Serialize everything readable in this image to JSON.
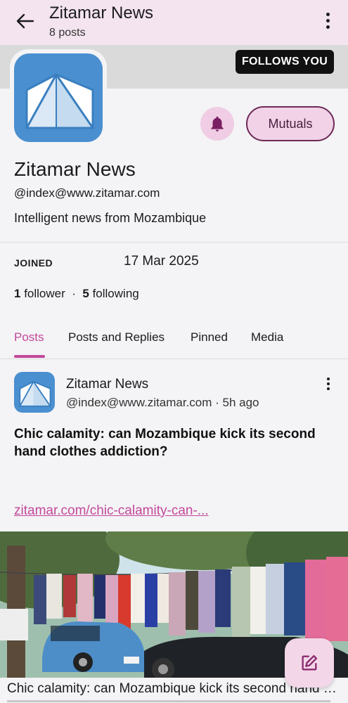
{
  "header": {
    "title": "Zitamar News",
    "subtitle": "8 posts"
  },
  "profile": {
    "follows_you_badge": "FOLLOWS YOU",
    "follow_button_label": "Mutuals",
    "display_name": "Zitamar News",
    "handle": "@index@www.zitamar.com",
    "bio": "Intelligent news from Mozambique",
    "joined_label": "JOINED",
    "joined_value": "17 Mar 2025",
    "followers_count": "1",
    "followers_label": "follower",
    "separator": "·",
    "following_count": "5",
    "following_label": "following"
  },
  "tabs": [
    {
      "label": "Posts",
      "active": true
    },
    {
      "label": "Posts and Replies",
      "active": false
    },
    {
      "label": "Pinned",
      "active": false
    },
    {
      "label": "Media",
      "active": false
    }
  ],
  "post": {
    "author": "Zitamar News",
    "meta": "@index@www.zitamar.com · 5h ago",
    "title": "Chic calamity: can Mozambique kick its second hand clothes addiction?",
    "link_text": "zitamar.com/chic-calamity-can-...",
    "card_caption": "Chic calamity: can Mozambique kick its second hand clothes addiction?"
  },
  "icons": {
    "back": "arrow-left-icon",
    "menu": "more-vertical-icon",
    "bell": "bell-icon",
    "compose": "compose-icon"
  },
  "colors": {
    "accent": "#c2489b",
    "topbar": "#f4e4ef",
    "logo_blue": "#4a8fd0"
  }
}
